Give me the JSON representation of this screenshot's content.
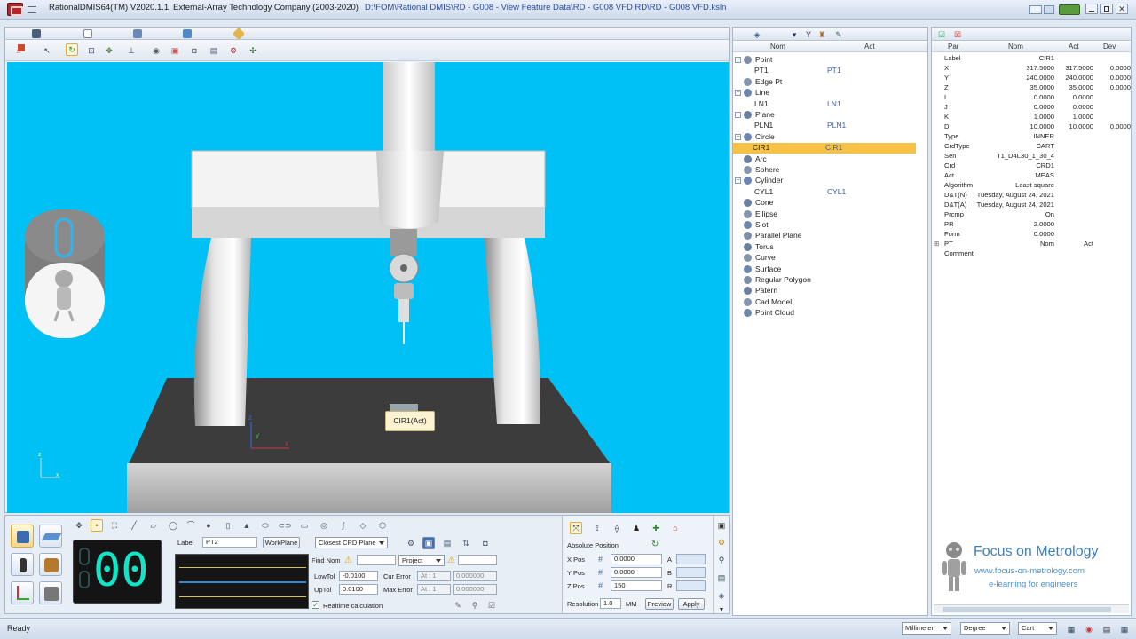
{
  "window": {
    "app_title": "RationalDMIS64(TM) V2020.1.1",
    "company": "External-Array Technology Company (2003-2020)",
    "file_path": "D:\\FOM\\Rational DMIS\\RD - G008 - View Feature Data\\RD - G008 VFD RD\\RD - G008 VFD.ksln"
  },
  "tree": {
    "headers": {
      "nom": "Nom",
      "act": "Act"
    },
    "items": [
      {
        "name": "Point",
        "act": "",
        "level": 0,
        "expander": "−"
      },
      {
        "name": "PT1",
        "act": "PT1",
        "level": 1,
        "expander": ""
      },
      {
        "name": "Edge Pt",
        "act": "",
        "level": 0,
        "expander": ""
      },
      {
        "name": "Line",
        "act": "",
        "level": 0,
        "expander": "−"
      },
      {
        "name": "LN1",
        "act": "LN1",
        "level": 1,
        "expander": ""
      },
      {
        "name": "Plane",
        "act": "",
        "level": 0,
        "expander": "−"
      },
      {
        "name": "PLN1",
        "act": "PLN1",
        "level": 1,
        "expander": ""
      },
      {
        "name": "Circle",
        "act": "",
        "level": 0,
        "expander": "−"
      },
      {
        "name": "CIR1",
        "act": "CIR1",
        "level": 1,
        "expander": "",
        "selected": true
      },
      {
        "name": "Arc",
        "act": "",
        "level": 0,
        "expander": ""
      },
      {
        "name": "Sphere",
        "act": "",
        "level": 0,
        "expander": ""
      },
      {
        "name": "Cylinder",
        "act": "",
        "level": 0,
        "expander": "−"
      },
      {
        "name": "CYL1",
        "act": "CYL1",
        "level": 1,
        "expander": ""
      },
      {
        "name": "Cone",
        "act": "",
        "level": 0,
        "expander": ""
      },
      {
        "name": "Ellipse",
        "act": "",
        "level": 0,
        "expander": ""
      },
      {
        "name": "Slot",
        "act": "",
        "level": 0,
        "expander": ""
      },
      {
        "name": "Parallel Plane",
        "act": "",
        "level": 0,
        "expander": ""
      },
      {
        "name": "Torus",
        "act": "",
        "level": 0,
        "expander": ""
      },
      {
        "name": "Curve",
        "act": "",
        "level": 0,
        "expander": ""
      },
      {
        "name": "Surface",
        "act": "",
        "level": 0,
        "expander": ""
      },
      {
        "name": "Regular Polygon",
        "act": "",
        "level": 0,
        "expander": ""
      },
      {
        "name": "Patern",
        "act": "",
        "level": 0,
        "expander": ""
      },
      {
        "name": "Cad Model",
        "act": "",
        "level": 0,
        "expander": ""
      },
      {
        "name": "Point Cloud",
        "act": "",
        "level": 0,
        "expander": ""
      }
    ]
  },
  "props": {
    "headers": {
      "par": "Par",
      "nom": "Nom",
      "act": "Act",
      "dev": "Dev"
    },
    "rows": [
      {
        "par": "Label",
        "nom": "CIR1",
        "act": "",
        "dev": ""
      },
      {
        "par": "X",
        "nom": "317.5000",
        "act": "317.5000",
        "dev": "0.0000"
      },
      {
        "par": "Y",
        "nom": "240.0000",
        "act": "240.0000",
        "dev": "0.0000"
      },
      {
        "par": "Z",
        "nom": "35.0000",
        "act": "35.0000",
        "dev": "0.0000"
      },
      {
        "par": "I",
        "nom": "0.0000",
        "act": "0.0000",
        "dev": ""
      },
      {
        "par": "J",
        "nom": "0.0000",
        "act": "0.0000",
        "dev": ""
      },
      {
        "par": "K",
        "nom": "1.0000",
        "act": "1.0000",
        "dev": ""
      },
      {
        "par": "D",
        "nom": "10.0000",
        "act": "10.0000",
        "dev": "0.0000"
      },
      {
        "par": "Type",
        "nom": "INNER",
        "act": "",
        "dev": ""
      },
      {
        "par": "CrdType",
        "nom": "CART",
        "act": "",
        "dev": ""
      },
      {
        "par": "Sen",
        "nom": "T1_D4L30_1_30_4",
        "act": "",
        "dev": ""
      },
      {
        "par": "Crd",
        "nom": "CRD1",
        "act": "",
        "dev": ""
      },
      {
        "par": "Act",
        "nom": "MEAS",
        "act": "",
        "dev": ""
      },
      {
        "par": "Algorithm",
        "nom": "Least square",
        "act": "",
        "dev": ""
      },
      {
        "par": "D&T(N)",
        "nom": "Tuesday, August 24, 2021",
        "act": "",
        "dev": ""
      },
      {
        "par": "D&T(A)",
        "nom": "Tuesday, August 24, 2021",
        "act": "",
        "dev": ""
      },
      {
        "par": "Prcmp",
        "nom": "On",
        "act": "",
        "dev": ""
      },
      {
        "par": "PR",
        "nom": "2.0000",
        "act": "",
        "dev": ""
      },
      {
        "par": "Form",
        "nom": "0.0000",
        "act": "",
        "dev": ""
      },
      {
        "par": "PT",
        "nom": "Nom",
        "act": "Act",
        "dev": ""
      },
      {
        "par": "Comment",
        "nom": "",
        "act": "",
        "dev": ""
      }
    ]
  },
  "viewport": {
    "tag_label": "CIR1(Act)",
    "background": "#00c1f6"
  },
  "bottom": {
    "counter": "00",
    "label_caption": "Label",
    "label_value": "PT2",
    "workplane_btn": "WorkPlane",
    "crd_plane": "Closest CRD Plane",
    "find_nom": "Find Nom",
    "project": "Project",
    "lowtol_caption": "LowTol",
    "lowtol_value": "-0.0100",
    "uptol_caption": "UpTol",
    "uptol_value": "0.0100",
    "cur_error": "Cur Error",
    "max_error": "Max Error",
    "at_placeholder": "At : 1",
    "error_value": "0.000000",
    "realtime": "Realtime calculation"
  },
  "position": {
    "title": "Absolute Position",
    "x_label": "X Pos",
    "x_value": "0.0000",
    "y_label": "Y Pos",
    "y_value": "0.0000",
    "z_label": "Z Pos",
    "z_value": "150",
    "a_label": "A",
    "b_label": "B",
    "r_label": "R",
    "resolution_label": "Resolution",
    "resolution_value": "1.0",
    "unit": "MM",
    "preview_btn": "Preview",
    "apply_btn": "Apply"
  },
  "branding": {
    "title": "Focus on Metrology",
    "url": "www.focus-on-metrology.com",
    "tagline": "e-learning for engineers"
  },
  "status": {
    "text": "Ready",
    "unit": "Millimeter",
    "angle": "Degree",
    "coord": "Cart"
  }
}
